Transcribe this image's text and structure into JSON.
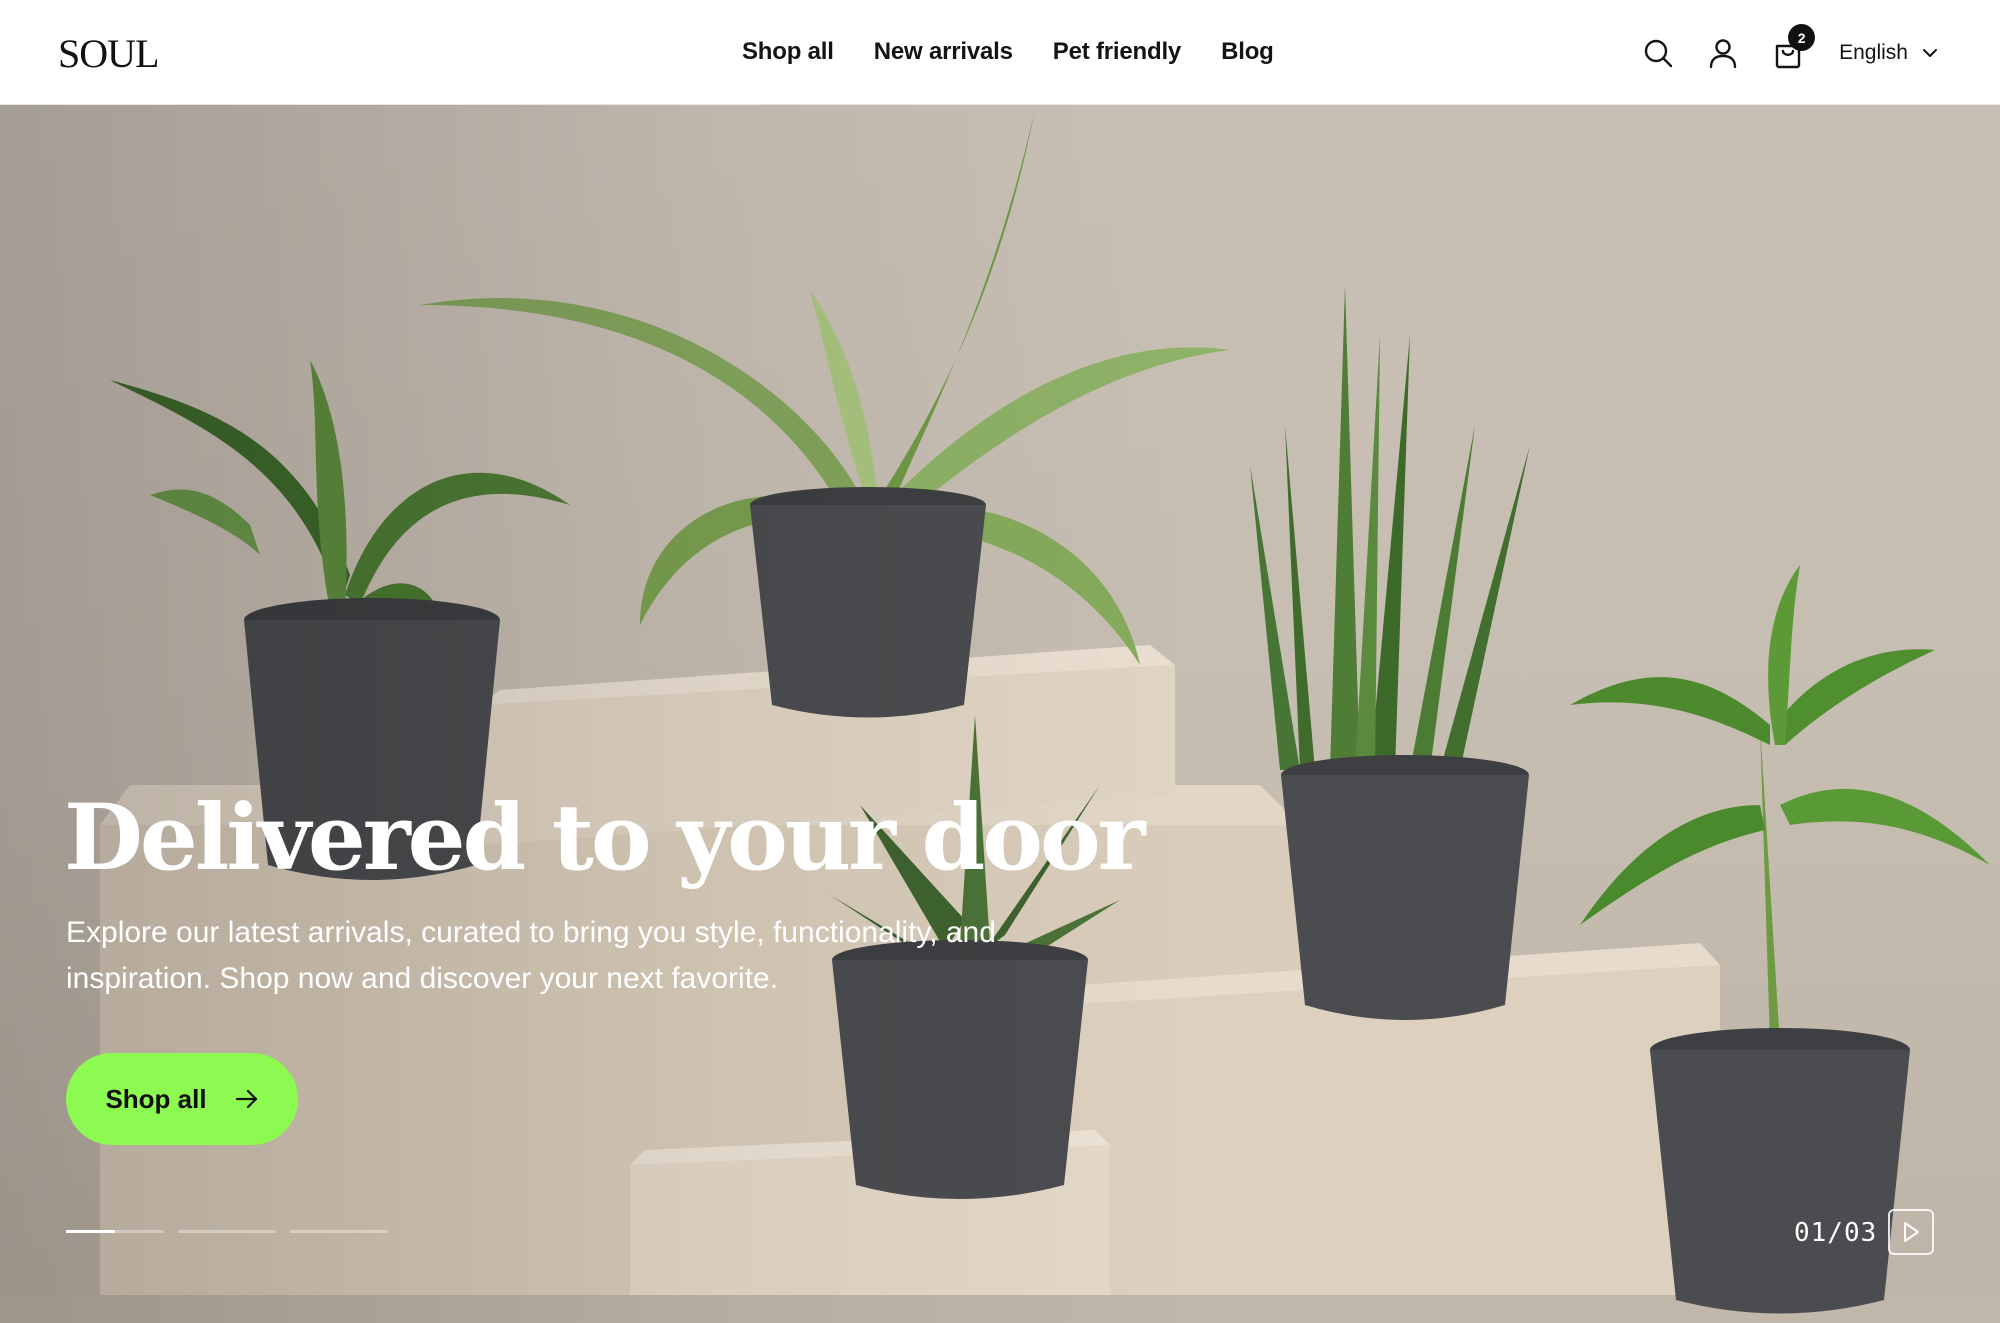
{
  "header": {
    "logo": "SOUL",
    "nav": [
      "Shop all",
      "New arrivals",
      "Pet friendly",
      "Blog"
    ],
    "icons": [
      "search-icon",
      "account-icon",
      "cart-icon"
    ],
    "cart_count": "2",
    "language": "English"
  },
  "hero": {
    "title": "Delivered to your door",
    "subtitle": "Explore our latest arrivals, curated to bring you style, functionality, and inspiration. Shop now and discover your next favorite.",
    "cta_label": "Shop all",
    "slide_counter": "01/03",
    "slide_progress": [
      0.5,
      0,
      0
    ],
    "colors": {
      "accent": "#8cfa50",
      "pot": "#4b4c4f",
      "block": "#ddd0bf",
      "wall": "#c8bfb4"
    }
  }
}
